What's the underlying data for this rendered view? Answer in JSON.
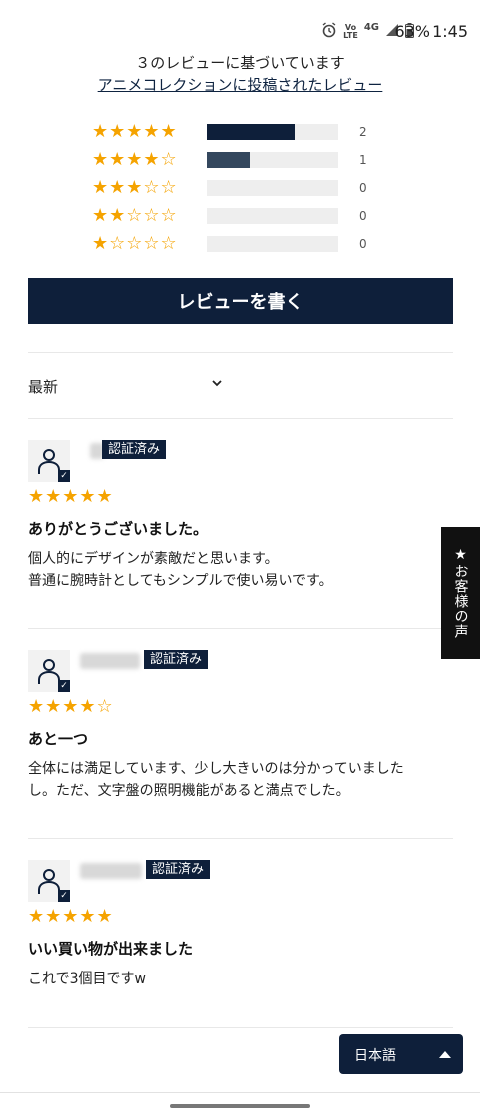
{
  "status_bar": {
    "alarm_icon": "alarm-clock-icon",
    "volte_line1": "Vo",
    "volte_line2": "LTE",
    "network": "4G",
    "battery_percent": "63%",
    "time": "1:45"
  },
  "summary": {
    "based_on": "３のレビューに基づいています",
    "collection_link": "アニメコレクションに投稿されたレビュー"
  },
  "histogram": [
    {
      "stars": "★★★★★",
      "count": "2",
      "fraction": 0.67
    },
    {
      "stars": "★★★★☆",
      "count": "1",
      "fraction": 0.33
    },
    {
      "stars": "★★★☆☆",
      "count": "0",
      "fraction": 0
    },
    {
      "stars": "★★☆☆☆",
      "count": "0",
      "fraction": 0
    },
    {
      "stars": "★☆☆☆☆",
      "count": "0",
      "fraction": 0
    }
  ],
  "write_review_label": "レビューを書く",
  "sort": {
    "selected": "最新"
  },
  "reviews": [
    {
      "verified": "認証済み",
      "stars": "★★★★★",
      "rating": 5,
      "title": "ありがとうございました。",
      "body": [
        "個人的にデザインが素敵だと思います。",
        "普通に腕時計としてもシンプルで使い易いです。"
      ]
    },
    {
      "verified": "認証済み",
      "stars": "★★★★☆",
      "rating": 4,
      "title": "あと一つ",
      "body": [
        "全体には満足しています、少し大きいのは分かっていました",
        "し。ただ、文字盤の照明機能があると満点でした。"
      ]
    },
    {
      "verified": "認証済み",
      "stars": "★★★★★",
      "rating": 5,
      "title": "いい買い物が出来ました",
      "body": [
        "これで3個目ですw"
      ]
    }
  ],
  "side_tab": "★お客様の声",
  "language": {
    "selected": "日本語"
  },
  "colors": {
    "navy": "#0e1f3a",
    "star": "#f5a300"
  }
}
